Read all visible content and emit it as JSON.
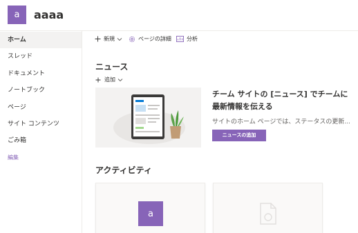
{
  "site": {
    "logo_letter": "a",
    "title": "aaaa"
  },
  "nav": {
    "items": [
      {
        "label": "ホーム",
        "active": true
      },
      {
        "label": "スレッド"
      },
      {
        "label": "ドキュメント"
      },
      {
        "label": "ノートブック"
      },
      {
        "label": "ページ"
      },
      {
        "label": "サイト コンテンツ"
      },
      {
        "label": "ごみ箱"
      }
    ],
    "edit_label": "編集"
  },
  "command_bar": {
    "new_label": "新規",
    "page_details_label": "ページの詳細",
    "analytics_label": "分析"
  },
  "news": {
    "title": "ニュース",
    "add_label": "追加",
    "heading": "チーム サイトの [ニュース] でチームに最新情報を伝える",
    "description": "サイトのホーム ページでは、ステータスの更新...",
    "add_news_button": "ニュースの追加"
  },
  "activity": {
    "title": "アクティビティ",
    "card_logo_letter": "a"
  },
  "colors": {
    "accent": "#8764b8",
    "nav_active_bg": "#f3f2f1"
  }
}
